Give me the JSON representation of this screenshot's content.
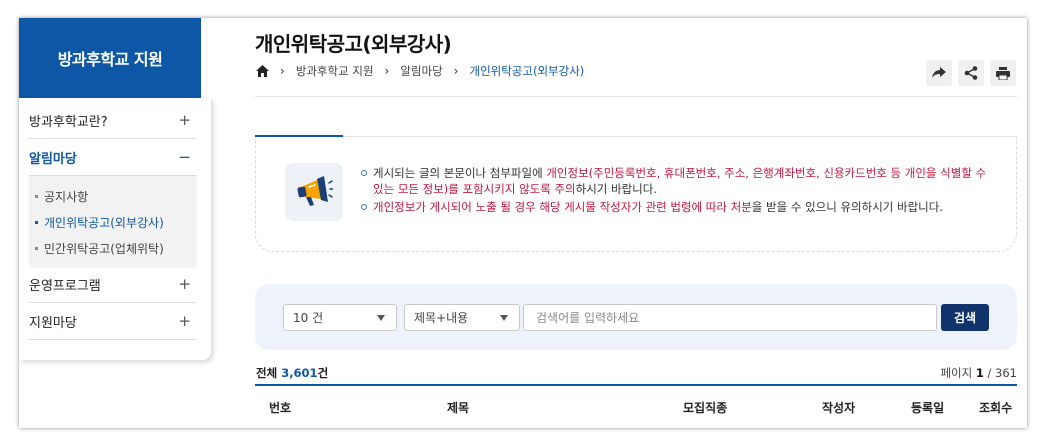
{
  "sidebar": {
    "header": "방과후학교 지원",
    "items": [
      {
        "label": "방과후학교란?",
        "sign": "+"
      },
      {
        "label": "알림마당",
        "sign": "−"
      },
      {
        "label": "운영프로그램",
        "sign": "+"
      },
      {
        "label": "지원마당",
        "sign": "+"
      }
    ],
    "subitems": [
      {
        "label": "공지사항"
      },
      {
        "label": "개인위탁공고(외부강사)"
      },
      {
        "label": "민간위탁공고(업체위탁)"
      }
    ]
  },
  "header": {
    "title": "개인위탁공고(외부강사)",
    "breadcrumb": [
      "방과후학교 지원",
      "알림마당",
      "개인위탁공고(외부강사)"
    ],
    "tools": [
      "share-arrow-icon",
      "share-icon",
      "print-icon"
    ]
  },
  "notice": {
    "line1_a": "게시되는 글의 본문이나 첨부파일에 ",
    "line1_b": "개인정보(주민등록번호, 휴대폰번호, 주소, 은행계좌번호, 신용카드번호 등 개인을 식별할 수 있는 모든 정보)를 포함시키지 않도록 주의",
    "line1_c": "하시기 바랍니다.",
    "line2_a": "개인정보가 게시되어 노출 될 경우 해당 게시물 작성자가 관련 법령에 따라 처분",
    "line2_b": "을 받을 수 있으니 유의하시기 바랍니다."
  },
  "search": {
    "page_size": "10 건",
    "field": "제목+내용",
    "placeholder": "검색어를 입력하세요",
    "button": "검색"
  },
  "summary": {
    "total_label": "전체",
    "total_count": "3,601",
    "total_unit": "건",
    "page_label": "페이지",
    "page_current": "1",
    "page_total": "/ 361"
  },
  "table": {
    "columns": [
      "번호",
      "제목",
      "모집직종",
      "작성자",
      "등록일",
      "조회수"
    ]
  },
  "colors": {
    "primary": "#0e57a6",
    "accent_red": "#c2183e",
    "button_dark": "#10336b"
  }
}
